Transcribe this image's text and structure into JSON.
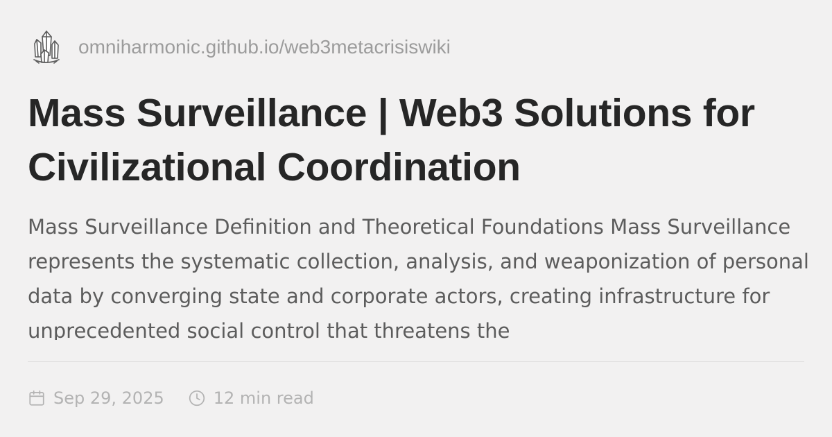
{
  "site": {
    "url": "omniharmonic.github.io/web3metacrisiswiki",
    "logo_icon": "crystal-cluster-icon"
  },
  "article": {
    "title": "Mass Surveillance | Web3 Solutions for Civilizational Coordination",
    "description": "Mass Surveillance Definition and Theoretical Foundations Mass Surveillance represents the systematic collection, analysis, and weaponization of personal data by converging state and corporate actors, creating infrastructure for unprecedented social control that threatens the"
  },
  "meta": {
    "date": "Sep 29, 2025",
    "date_icon": "calendar-icon",
    "read_time": "12 min read",
    "read_time_icon": "clock-icon"
  },
  "colors": {
    "background": "#f2f1f1",
    "title": "#262626",
    "description": "#5c5c5c",
    "muted": "#9c9c9c",
    "divider": "#dcdbdb"
  }
}
